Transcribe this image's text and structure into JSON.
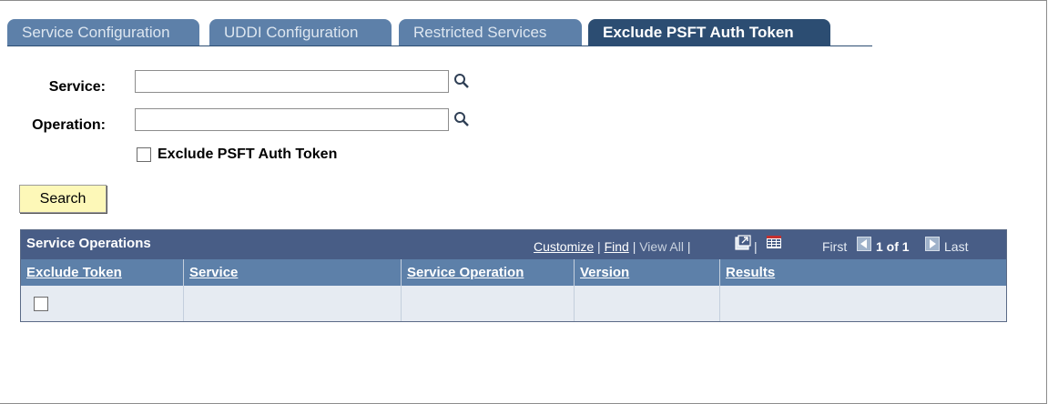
{
  "tabs": [
    {
      "label": "Service Configuration",
      "active": false
    },
    {
      "label": "UDDI Configuration",
      "active": false
    },
    {
      "label": "Restricted Services",
      "active": false
    },
    {
      "label": "Exclude PSFT Auth Token",
      "active": true
    }
  ],
  "form": {
    "service_label": "Service:",
    "service_value": "",
    "operation_label": "Operation:",
    "operation_value": "",
    "exclude_checkbox_label": "Exclude PSFT Auth Token",
    "exclude_checked": false,
    "search_button": "Search"
  },
  "grid": {
    "title": "Service Operations",
    "customize": "Customize",
    "find": "Find",
    "view_all": "View All",
    "first": "First",
    "range": "1 of 1",
    "last": "Last",
    "columns": [
      "Exclude Token",
      "Service",
      "Service Operation",
      "Version",
      "Results"
    ],
    "rows": [
      {
        "exclude_token": false,
        "service": "",
        "service_operation": "",
        "version": "",
        "results": ""
      }
    ]
  },
  "colors": {
    "tab_inactive": "#5d80a9",
    "tab_active": "#2c4d72",
    "grid_header": "#485d86",
    "search_button": "#fdf8b8"
  }
}
